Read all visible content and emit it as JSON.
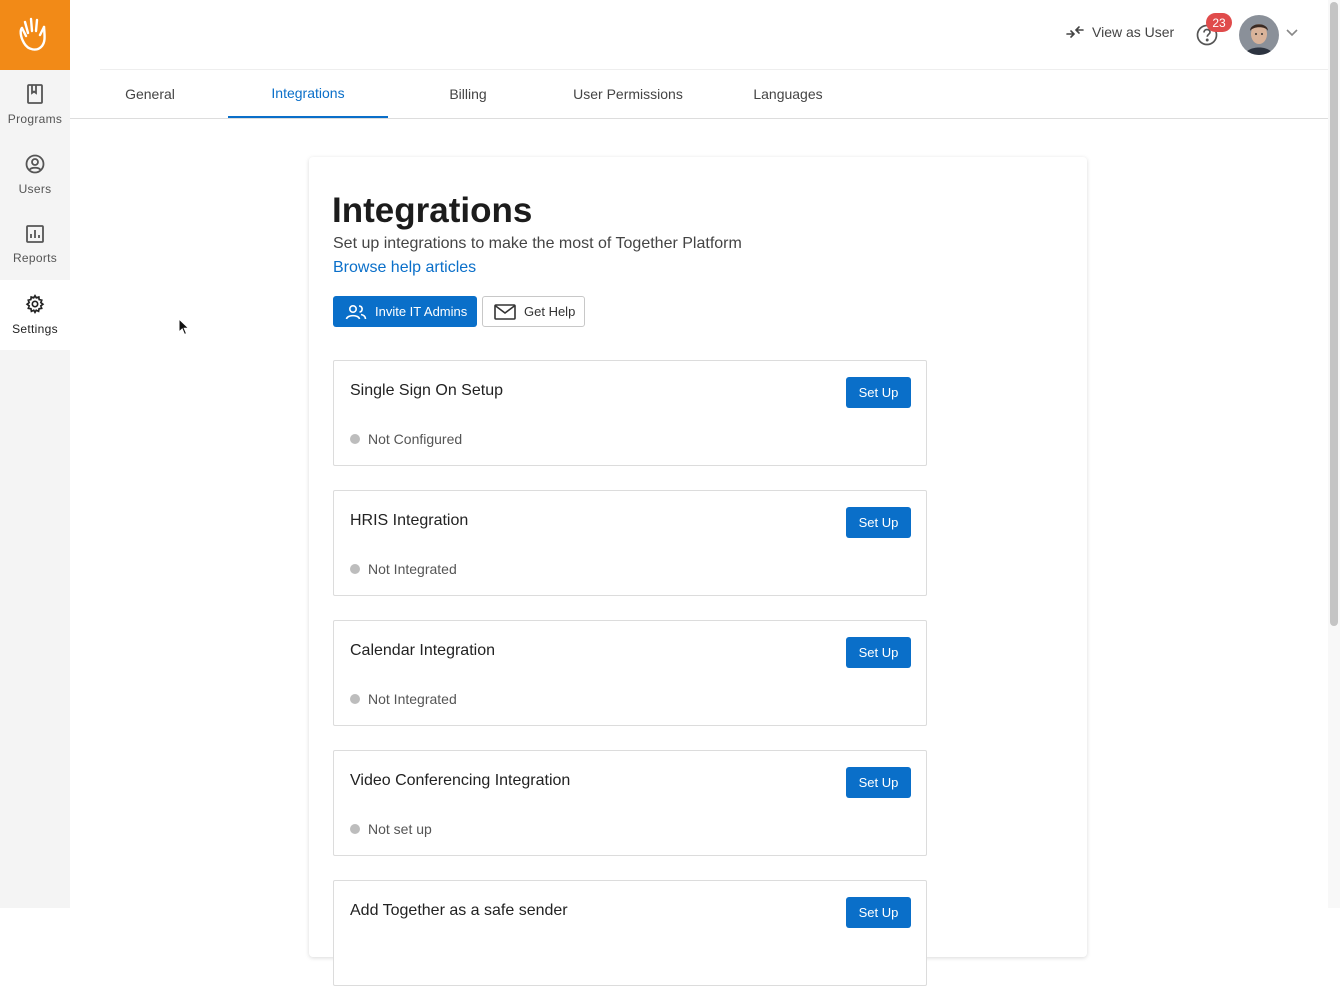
{
  "rail": {
    "items": [
      {
        "label": "Programs",
        "icon": "book-icon"
      },
      {
        "label": "Users",
        "icon": "user-circle-icon"
      },
      {
        "label": "Reports",
        "icon": "bar-chart-icon"
      },
      {
        "label": "Settings",
        "icon": "gear-icon"
      }
    ]
  },
  "header": {
    "view_as_user": "View as User",
    "notification_count": "23"
  },
  "tabs": [
    {
      "label": "General"
    },
    {
      "label": "Integrations"
    },
    {
      "label": "Billing"
    },
    {
      "label": "User Permissions"
    },
    {
      "label": "Languages"
    }
  ],
  "main": {
    "title": "Integrations",
    "subtitle": "Set up integrations to make the most of Together Platform",
    "help_link": "Browse help articles",
    "invite_button": "Invite IT Admins",
    "help_button": "Get Help",
    "integrations": [
      {
        "title": "Single Sign On Setup",
        "status": "Not Configured",
        "button": "Set Up"
      },
      {
        "title": "HRIS Integration",
        "status": "Not Integrated",
        "button": "Set Up"
      },
      {
        "title": "Calendar Integration",
        "status": "Not Integrated",
        "button": "Set Up"
      },
      {
        "title": "Video Conferencing Integration",
        "status": "Not set up",
        "button": "Set Up"
      },
      {
        "title": "Add Together as a safe sender",
        "status": "",
        "button": "Set Up"
      }
    ]
  },
  "colors": {
    "brand": "#f28a17",
    "accent": "#0a6fc9",
    "badge": "#e04b4b",
    "status_dot": "#bdbdbd"
  }
}
